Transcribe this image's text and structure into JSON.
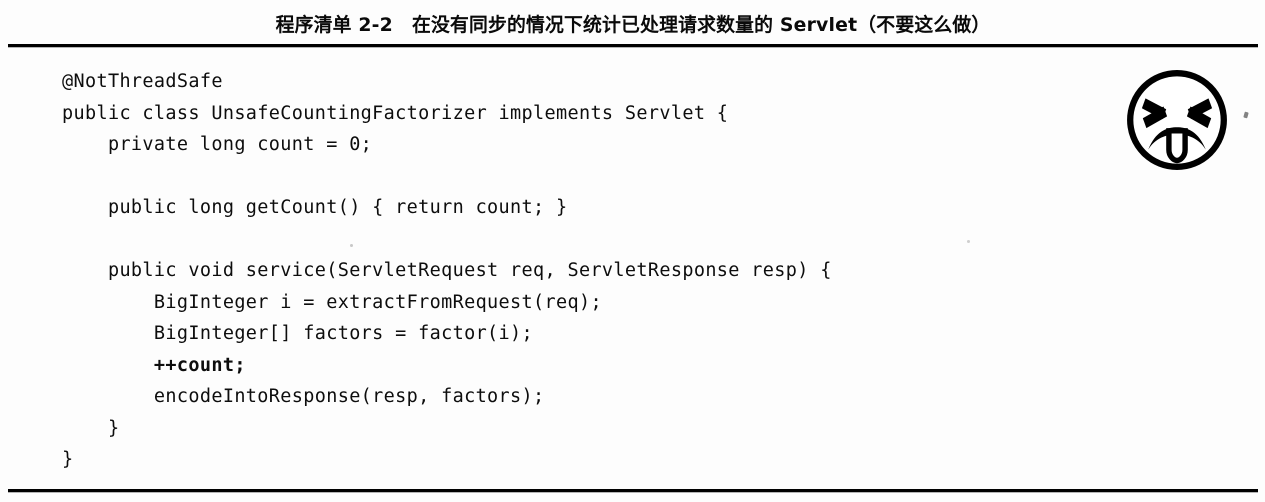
{
  "caption": {
    "text": "程序清单 2-2　在没有同步的情况下统计已处理请求数量的 Servlet（不要这么做）"
  },
  "code": {
    "language": "java",
    "lines": [
      {
        "text": "@NotThreadSafe",
        "bold": false
      },
      {
        "text": "public class UnsafeCountingFactorizer implements Servlet {",
        "bold": false
      },
      {
        "text": "    private long count = 0;",
        "bold": false
      },
      {
        "text": "",
        "bold": false
      },
      {
        "text": "    public long getCount() { return count; }",
        "bold": false
      },
      {
        "text": "",
        "bold": false
      },
      {
        "text": "    public void service(ServletRequest req, ServletResponse resp) {",
        "bold": false
      },
      {
        "text": "        BigInteger i = extractFromRequest(req);",
        "bold": false
      },
      {
        "text": "        BigInteger[] factors = factor(i);",
        "bold": false
      },
      {
        "text": "        ++count;",
        "bold": true
      },
      {
        "text": "        encodeIntoResponse(resp, factors);",
        "bold": false
      },
      {
        "text": "    }",
        "bold": false
      },
      {
        "text": "}",
        "bold": false
      }
    ]
  },
  "icon": {
    "name": "disgusted-face-do-not-do-this-icon",
    "meaning": "不要这么做",
    "color": "#000000"
  },
  "colors": {
    "ink": "#000000",
    "page": "#fdfdfd",
    "rule": "#000000"
  }
}
